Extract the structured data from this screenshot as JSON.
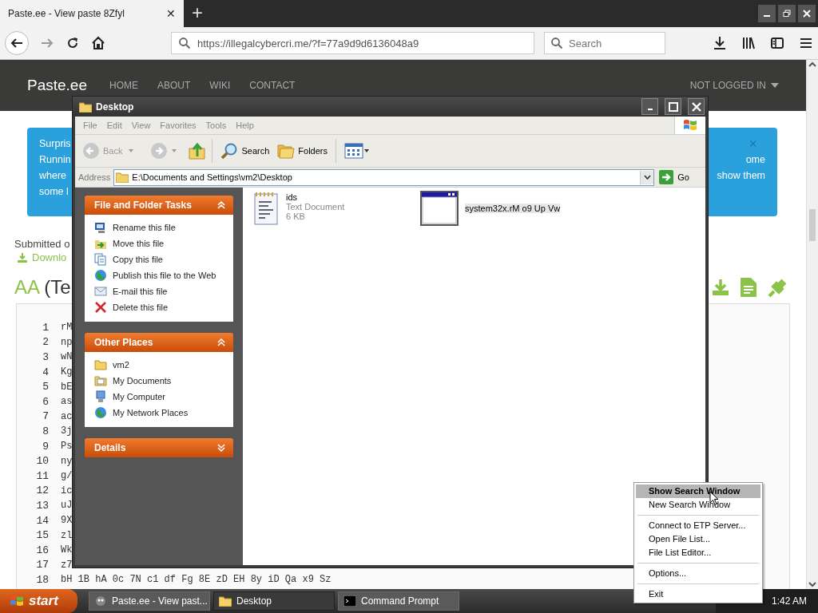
{
  "browser": {
    "tab": {
      "title": "Paste.ee - View paste 8Zfyl",
      "close": "✕"
    },
    "new_tab": "+",
    "url": "https://illegalcybercri.me/?f=77a9d9d6136048a9",
    "search": {
      "placeholder": "Search"
    }
  },
  "site": {
    "brand": "Paste.ee",
    "nav": [
      {
        "label": "HOME"
      },
      {
        "label": "ABOUT"
      },
      {
        "label": "WIKI"
      },
      {
        "label": "CONTACT"
      }
    ],
    "account": "NOT LOGGED IN",
    "banner": {
      "left_lines": [
        "Surpris",
        "Runnin",
        "where",
        "some l"
      ],
      "right_lines": [
        "ome",
        "show them"
      ],
      "close": "×"
    },
    "submitted": "Submitted o",
    "download": "Downlo",
    "title_main": "AA",
    "title_rest": "(Te",
    "code_lines": [
      {
        "number": "1",
        "text": "rM"
      },
      {
        "number": "2",
        "text": "np"
      },
      {
        "number": "3",
        "text": "wN"
      },
      {
        "number": "4",
        "text": "Kg"
      },
      {
        "number": "5",
        "text": "bE"
      },
      {
        "number": "6",
        "text": "as"
      },
      {
        "number": "7",
        "text": "ac"
      },
      {
        "number": "8",
        "text": "3j"
      },
      {
        "number": "9",
        "text": "Ps"
      },
      {
        "number": "10",
        "text": "ny"
      },
      {
        "number": "11",
        "text": "g/"
      },
      {
        "number": "12",
        "text": "ic"
      },
      {
        "number": "13",
        "text": "uJ"
      },
      {
        "number": "14",
        "text": "9X"
      },
      {
        "number": "15",
        "text": "zl"
      },
      {
        "number": "16",
        "text": "Wk"
      },
      {
        "number": "17",
        "text": "z7"
      },
      {
        "number": "18",
        "text": "bH 1B hA 0c 7N c1 df Fg 8E zD EH 8y iD Qa x9 Sz"
      }
    ]
  },
  "explorer": {
    "title": "Desktop",
    "menu": [
      "File",
      "Edit",
      "View",
      "Favorites",
      "Tools",
      "Help"
    ],
    "toolbar": {
      "back": {
        "label": "Back",
        "disabled": true
      },
      "search": "Search",
      "folders": "Folders"
    },
    "address": {
      "label": "Address",
      "path": "E:\\Documents and Settings\\vm2\\Desktop",
      "go": "Go"
    },
    "panels": [
      {
        "title": "File and Folder Tasks",
        "expanded": true,
        "items": [
          {
            "label": "Rename this file",
            "kind": "rename"
          },
          {
            "label": "Move this file",
            "kind": "move"
          },
          {
            "label": "Copy this file",
            "kind": "copy"
          },
          {
            "label": "Publish this file to the Web",
            "kind": "publish"
          },
          {
            "label": "E-mail this file",
            "kind": "email"
          },
          {
            "label": "Delete this file",
            "kind": "delete"
          }
        ]
      },
      {
        "title": "Other Places",
        "expanded": true,
        "items": [
          {
            "label": "vm2",
            "kind": "folder"
          },
          {
            "label": "My Documents",
            "kind": "documents"
          },
          {
            "label": "My Computer",
            "kind": "computer"
          },
          {
            "label": "My Network Places",
            "kind": "network"
          }
        ]
      },
      {
        "title": "Details",
        "expanded": false
      }
    ],
    "files": [
      {
        "kind": "text",
        "name": "ids",
        "type": "Text Document",
        "size": "6 KB",
        "selected": false
      },
      {
        "kind": "app",
        "name": "system32x.rM o9 Up Vw",
        "selected": true
      }
    ]
  },
  "context_menu": [
    [
      {
        "label": "Show Search Window",
        "default": true,
        "selected": true
      },
      {
        "label": "New Search Window",
        "default": false,
        "selected": false
      }
    ],
    [
      {
        "label": "Connect to ETP Server...",
        "default": false,
        "selected": false
      },
      {
        "label": "Open File List...",
        "default": false,
        "selected": false
      },
      {
        "label": "File List Editor...",
        "default": false,
        "selected": false
      }
    ],
    [
      {
        "label": "Options...",
        "default": false,
        "selected": false
      }
    ],
    [
      {
        "label": "Exit",
        "default": false,
        "selected": false
      }
    ]
  ],
  "taskbar": {
    "start": "start",
    "tasks": [
      {
        "label": "Paste.ee - View past...",
        "kind": "app",
        "selected": false
      },
      {
        "label": "Desktop",
        "kind": "folder",
        "selected": true
      },
      {
        "label": "Command Prompt",
        "kind": "console",
        "selected": false
      }
    ],
    "clock": "1:42 AM"
  }
}
